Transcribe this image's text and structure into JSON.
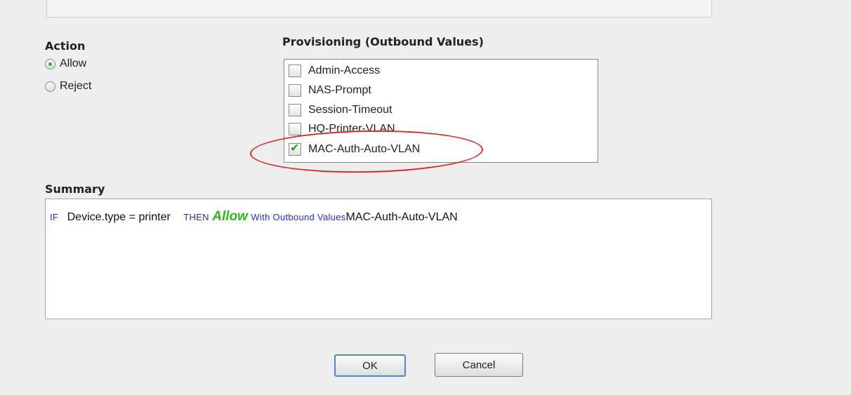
{
  "action": {
    "heading": "Action",
    "options": [
      {
        "label": "Allow",
        "selected": true
      },
      {
        "label": "Reject",
        "selected": false
      }
    ]
  },
  "provisioning": {
    "heading": "Provisioning (Outbound Values)",
    "items": [
      {
        "label": "Admin-Access",
        "checked": false
      },
      {
        "label": "NAS-Prompt",
        "checked": false
      },
      {
        "label": "Session-Timeout",
        "checked": false
      },
      {
        "label": "HQ-Printer-VLAN",
        "checked": false
      },
      {
        "label": "MAC-Auth-Auto-VLAN",
        "checked": true
      }
    ]
  },
  "summary": {
    "heading": "Summary",
    "if_kw": "IF",
    "condition": "Device.type = printer",
    "then_kw": "THEN",
    "action_word": "Allow",
    "with_kw": "With Outbound Values",
    "value": "MAC-Auth-Auto-VLAN"
  },
  "buttons": {
    "ok": "OK",
    "cancel": "Cancel"
  },
  "colors": {
    "highlight_ellipse": "#dd2a2a",
    "allow_green": "#2aba1e",
    "keyword_blue": "#1c2fe0"
  }
}
